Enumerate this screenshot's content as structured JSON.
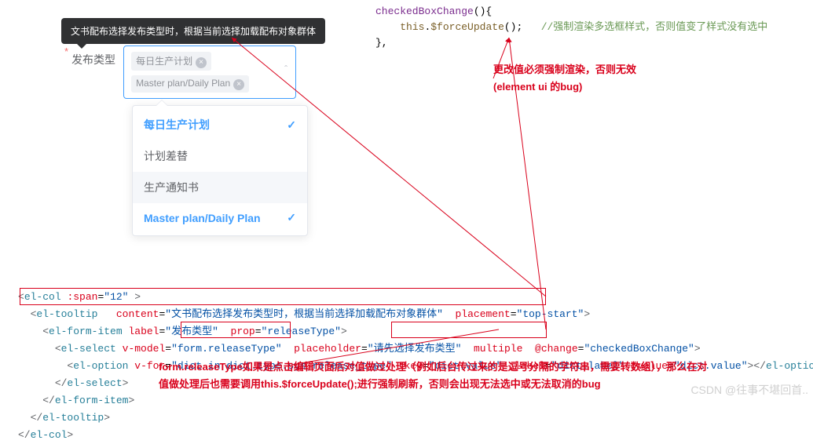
{
  "tooltip": "文书配布选择发布类型时，根据当前选择加载配布对象群体",
  "form": {
    "required_mark": "*",
    "label": "发布类型",
    "tags": [
      "每日生产计划",
      "Master plan/Daily Plan"
    ],
    "caret": "ˆ"
  },
  "dropdown": {
    "items": [
      {
        "label": "每日生产计划",
        "selected": true,
        "hover": false
      },
      {
        "label": "计划差替",
        "selected": false,
        "hover": false
      },
      {
        "label": "生产通知书",
        "selected": false,
        "hover": true
      },
      {
        "label": "Master plan/Daily Plan",
        "selected": true,
        "hover": false
      }
    ],
    "check": "✓"
  },
  "code_top": {
    "fn": "checkedBoxChange",
    "paren": "(){",
    "body": "this.$forceUpdate();",
    "comment": "//强制渲染多选框样式，否则值变了样式没有选中",
    "close": "},"
  },
  "note1": {
    "l1": "更改值必须强制渲染，否则无效",
    "l2": "(element ui 的bug)"
  },
  "code_bottom": {
    "line1_pre": "<el-col :span=",
    "line1_val": "\"12\"",
    "line1_post": " >",
    "line2_pre": "<el-tooltip   content=",
    "line2_v1": "\"文书配布选择发布类型时，根据当前选择加载配布对象群体\"",
    "line2_mid": "  placement=",
    "line2_v2": "\"top-start\"",
    "line2_close": ">",
    "line3_pre": "<el-form-item label=",
    "line3_v1": "\"发布类型\"",
    "line3_mid": "  prop=",
    "line3_v2": "\"releaseType\"",
    "line3_close": ">",
    "line4_pre": "<el-select v-model=",
    "line4_v1": "\"form.releaseType\"",
    "line4_mid1": "  placeholder=",
    "line4_v2": "\"请先选择发布类型\"",
    "line4_mid2": "  multiple  @change=",
    "line4_v3": "\"checkedBoxChange\"",
    "line4_close": ">",
    "line5_pre": "<el-option v-for=",
    "line5_v1": "\"dict in dict.type.sys_release_type\"",
    "line5_mid1": " :key=",
    "line5_v2": "\"dict.value\"",
    "line5_mid2": " :label=",
    "line5_v3": "\"dict.label\"",
    "line5_mid3": " :value=",
    "line5_v4": "\"dict.value\"",
    "line5_close": "></el-option>",
    "line6": "</el-select>",
    "line7": "</el-form-item>",
    "line8": "</el-tooltip>",
    "line9": "</el-col>"
  },
  "note2": {
    "l1": "form.releaseType如果是点击编辑页面后对值做过处理（例如后台传过来的是逗号分隔的字符串，需要转数组），那么在对",
    "l2": "值做处理后也需要调用this.$forceUpdate();进行强制刷新，否则会出现无法选中或无法取消的bug"
  },
  "watermark": "CSDN @往事不堪回首.."
}
